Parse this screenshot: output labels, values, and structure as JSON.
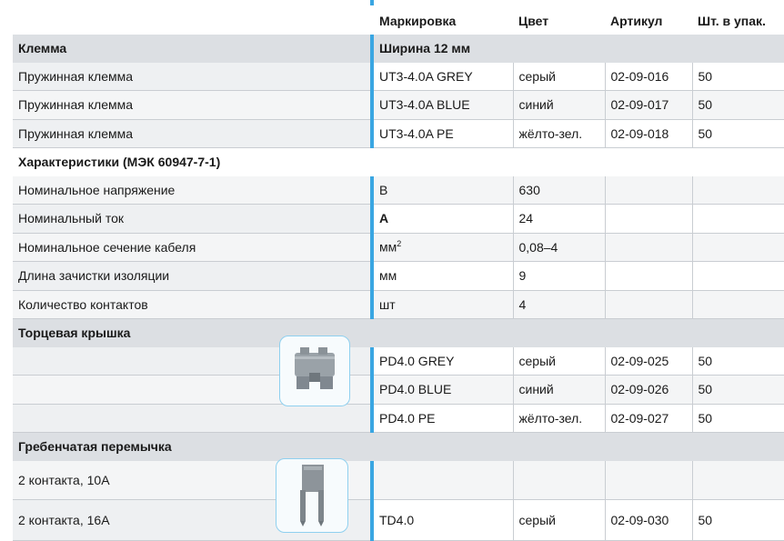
{
  "header": {
    "marking": "Маркировка",
    "color": "Цвет",
    "article": "Артикул",
    "pack": "Шт. в упак."
  },
  "terminal_section": {
    "title": "Клемма",
    "width": "Ширина 12 мм",
    "rows": [
      {
        "name": "Пружинная клемма",
        "marking": "UT3-4.0A GREY",
        "color": "серый",
        "article": "02-09-016",
        "pack": "50"
      },
      {
        "name": "Пружинная клемма",
        "marking": "UT3-4.0A BLUE",
        "color": "синий",
        "article": "02-09-017",
        "pack": "50"
      },
      {
        "name": "Пружинная клемма",
        "marking": "UT3-4.0A PE",
        "color": "жёлто-зел.",
        "article": "02-09-018",
        "pack": "50"
      }
    ]
  },
  "specs_section": {
    "title": "Характеристики (МЭК 60947-7-1)",
    "rows": [
      {
        "name": "Номинальное напряжение",
        "unit": "В",
        "value": "630"
      },
      {
        "name": "Номинальный ток",
        "unit": "А",
        "value": "24"
      },
      {
        "name": "Номинальное сечение кабеля",
        "unit": "мм",
        "unit_sup": "2",
        "value": "0,08–4"
      },
      {
        "name": "Длина зачистки изоляции",
        "unit": "мм",
        "value": "9"
      },
      {
        "name": "Количество контактов",
        "unit": "шт",
        "value": "4"
      }
    ]
  },
  "endcap_section": {
    "title": "Торцевая крышка",
    "rows": [
      {
        "marking": "PD4.0 GREY",
        "color": "серый",
        "article": "02-09-025",
        "pack": "50"
      },
      {
        "marking": "PD4.0 BLUE",
        "color": "синий",
        "article": "02-09-026",
        "pack": "50"
      },
      {
        "marking": "PD4.0 PE",
        "color": "жёлто-зел.",
        "article": "02-09-027",
        "pack": "50"
      }
    ]
  },
  "jumper_section": {
    "title": "Гребенчатая перемычка",
    "rows": [
      {
        "name": "2 контакта, 10А",
        "marking": "",
        "color": "",
        "article": "",
        "pack": ""
      },
      {
        "name": "2 контакта, 16А",
        "marking": "TD4.0",
        "color": "серый",
        "article": "02-09-030",
        "pack": "50"
      }
    ]
  },
  "colors": {
    "accent": "#3aa6e2",
    "section_bg": "#dcdfe3"
  }
}
